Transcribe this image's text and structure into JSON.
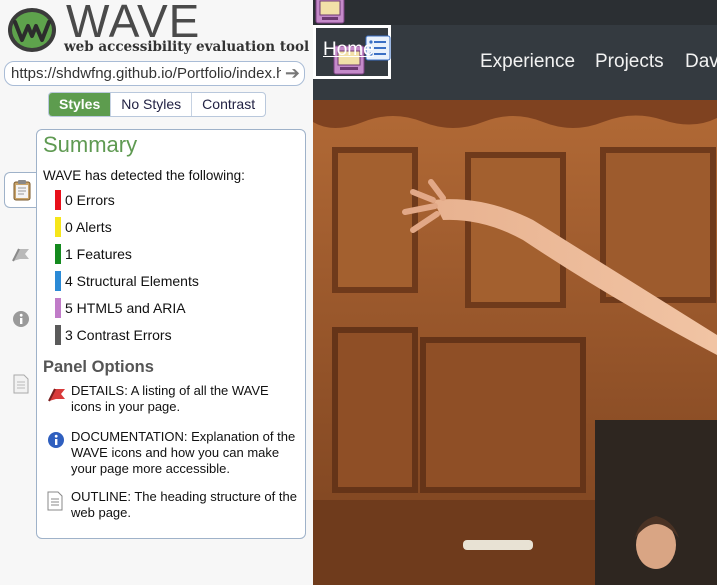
{
  "wave": {
    "logo_word": "WAVE",
    "tagline": "web accessibility evaluation tool",
    "url": "https://shdwfng.github.io/Portfolio/index.html",
    "view_buttons": [
      "Styles",
      "No Styles",
      "Contrast"
    ],
    "active_view": "Styles",
    "side_tabs": [
      {
        "name": "summary",
        "icon": "clipboard-icon",
        "active": true
      },
      {
        "name": "details",
        "icon": "flag-icon",
        "active": false
      },
      {
        "name": "documentation",
        "icon": "info-icon",
        "active": false
      },
      {
        "name": "outline",
        "icon": "document-icon",
        "active": false
      }
    ],
    "summary": {
      "title": "Summary",
      "intro": "WAVE has detected the following:",
      "stats": [
        {
          "count": 0,
          "label": "0 Errors",
          "color": "#e8101a"
        },
        {
          "count": 0,
          "label": "0 Alerts",
          "color": "#f6e61a"
        },
        {
          "count": 1,
          "label": "1 Features",
          "color": "#148a1e"
        },
        {
          "count": 4,
          "label": "4 Structural Elements",
          "color": "#2b8ad6"
        },
        {
          "count": 5,
          "label": "5 HTML5 and ARIA",
          "color": "#c07bc8"
        },
        {
          "count": 3,
          "label": "3 Contrast Errors",
          "color": "#5a5a5a"
        }
      ]
    },
    "panel_options": {
      "title": "Panel Options",
      "details": "DETAILS: A listing of all the WAVE icons in your page.",
      "documentation": "DOCUMENTATION: Explanation of the WAVE icons and how you can make your page more accessible.",
      "outline": "OUTLINE: The heading structure of the web page."
    }
  },
  "site": {
    "nav": {
      "links": [
        "Home",
        "Experience",
        "Projects",
        "Dav"
      ],
      "active": "Home"
    },
    "colors": {
      "nav_bg": "#343a40",
      "topbar_bg": "#2b2f33",
      "wave_green": "#5d9c4e"
    }
  }
}
